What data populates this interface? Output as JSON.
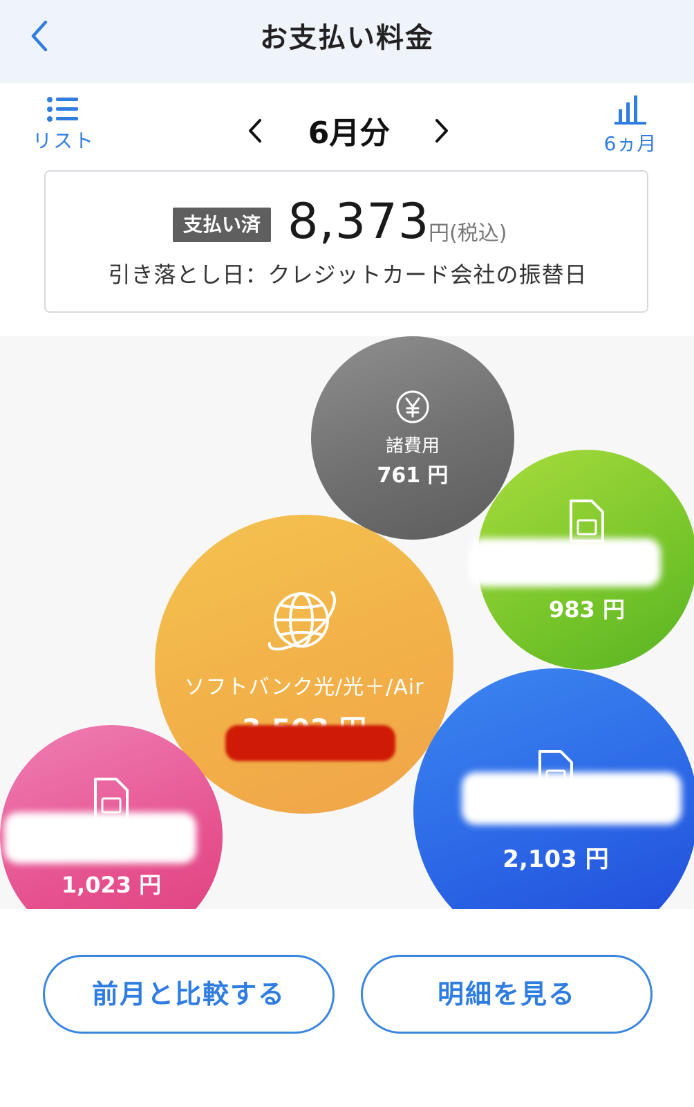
{
  "header": {
    "title": "お支払い料金"
  },
  "nav": {
    "list_label": "リスト",
    "month_label": "6月分",
    "six_month_label": "6ヵ月"
  },
  "summary": {
    "status_badge": "支払い済",
    "amount": "8,373",
    "unit": "円(税込)",
    "withdrawal": "引き落とし日：クレジットカード会社の振替日"
  },
  "bubbles": {
    "fees": {
      "name": "諸費用",
      "amount": "761 円",
      "color": "#7a7a7a"
    },
    "green": {
      "amount": "983 円",
      "color": "#7ac52a"
    },
    "hikari": {
      "name": "ソフトバンク光/光＋/Air",
      "amount": "3,503 円",
      "color": "#f2b048"
    },
    "blue": {
      "amount": "2,103 円",
      "color": "#2b67e6"
    },
    "pink": {
      "amount": "1,023 円",
      "color": "#e6528f"
    }
  },
  "buttons": {
    "compare": "前月と比較する",
    "detail": "明細を見る"
  },
  "accent": "#2f7de1"
}
